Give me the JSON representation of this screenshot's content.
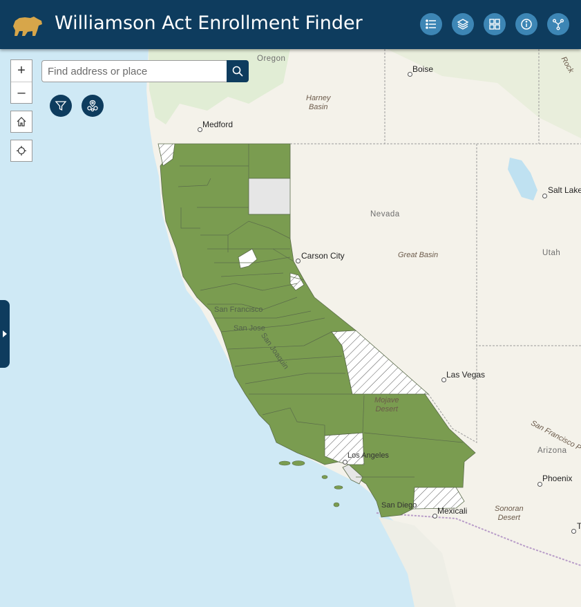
{
  "app": {
    "title": "Williamson Act Enrollment Finder"
  },
  "header": {
    "buttons": [
      {
        "name": "legend-button",
        "icon": "list-icon"
      },
      {
        "name": "layers-button",
        "icon": "layers-icon"
      },
      {
        "name": "basemap-button",
        "icon": "grid-icon"
      },
      {
        "name": "about-button",
        "icon": "info-icon"
      },
      {
        "name": "share-button",
        "icon": "share-icon"
      }
    ]
  },
  "search": {
    "placeholder": "Find address or place",
    "icon": "search-icon"
  },
  "controls": {
    "zoom_in": "+",
    "zoom_out": "–",
    "home": "home-icon",
    "locate": "locate-icon",
    "filter": "filter-icon",
    "cluster": "cluster-icon",
    "side_panel": "expand-arrow-icon"
  },
  "colors": {
    "header": "#0e3c5e",
    "header_button": "#3d86b5",
    "enrolled": "#7a9c50",
    "no_data": "#e6e6e6",
    "not_enrolled": "#ffffff",
    "ocean": "#cfe9f5"
  },
  "map": {
    "states": {
      "oregon": "Oregon",
      "nevada": "Nevada",
      "utah": "Utah",
      "arizona": "Arizona"
    },
    "regions": {
      "harney": [
        "Harney",
        "Basin"
      ],
      "great_basin": "Great Basin",
      "mojave": [
        "Mojave",
        "Desert"
      ],
      "sonoran": [
        "Sonoran",
        "Desert"
      ],
      "san_francisco_peaks": "San Francisco P",
      "rocky": "Rock"
    },
    "cities": {
      "boise": "Boise",
      "medford": "Medford",
      "salt_lake": "Salt Lake",
      "carson_city": "Carson City",
      "las_vegas": "Las Vegas",
      "phoenix": "Phoenix",
      "mexicali": "Mexicali",
      "t_edge": "T"
    },
    "overlays": {
      "san_francisco": "San Francisco",
      "san_jose": "San Jose",
      "san_joaquin": "San Joaquin",
      "los_angeles": "Los Angeles",
      "san_diego": "San Diego"
    },
    "legend_classes": [
      "enrolled",
      "no_data",
      "not_enrolled"
    ]
  }
}
